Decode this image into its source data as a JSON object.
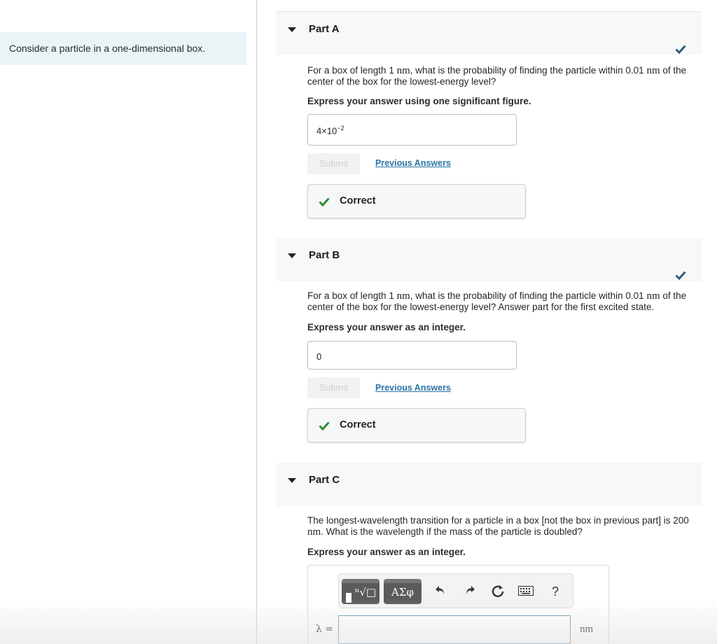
{
  "intro": "Consider a particle in a one-dimensional box.",
  "colors": {
    "accent_check": "#2b5d7a",
    "correct_green": "#2f8a3c",
    "link": "#2b74a5",
    "intro_bg": "#e9f4f7"
  },
  "parts": [
    {
      "title": "Part A",
      "status_icon": "check-icon",
      "question_pre": "For a box of length 1 ",
      "unit1": "nm",
      "question_mid": ", what is the probability of finding the particle within 0.01 ",
      "unit2": "nm",
      "question_post": " of the center of the box for the lowest-energy level?",
      "instruction": "Express your answer using one significant figure.",
      "answer_base": "4×10",
      "answer_exp": "−2",
      "submit_label": "Submit",
      "previous_answers_label": "Previous Answers",
      "feedback_label": "Correct"
    },
    {
      "title": "Part B",
      "status_icon": "check-icon",
      "question_pre": "For a box of length 1 ",
      "unit1": "nm",
      "question_mid": ", what is the probability of finding the particle within 0.01 ",
      "unit2": "nm",
      "question_post": " of the center of the box for the lowest-energy level? Answer part for the first excited state.",
      "instruction": "Express your answer as an integer.",
      "answer": "0",
      "submit_label": "Submit",
      "previous_answers_label": "Previous Answers",
      "feedback_label": "Correct"
    },
    {
      "title": "Part C",
      "question_pre": "The longest-wavelength transition for a particle in a box [not the box in previous part] is 200 ",
      "unit1": "nm",
      "question_post": ". What is the wavelength if the mass of the particle is doubled?",
      "instruction": "Express your answer as an integer.",
      "toolbar": {
        "templates_symbol": "ⁿ√□",
        "greek_symbol": "ΑΣφ",
        "undo_icon": "undo-icon",
        "redo_icon": "redo-icon",
        "reset_icon": "reset-icon",
        "keyboard_icon": "keyboard-icon",
        "help_label": "?"
      },
      "variable_label": "λ =",
      "answer_value": "",
      "unit_label": "nm"
    }
  ]
}
